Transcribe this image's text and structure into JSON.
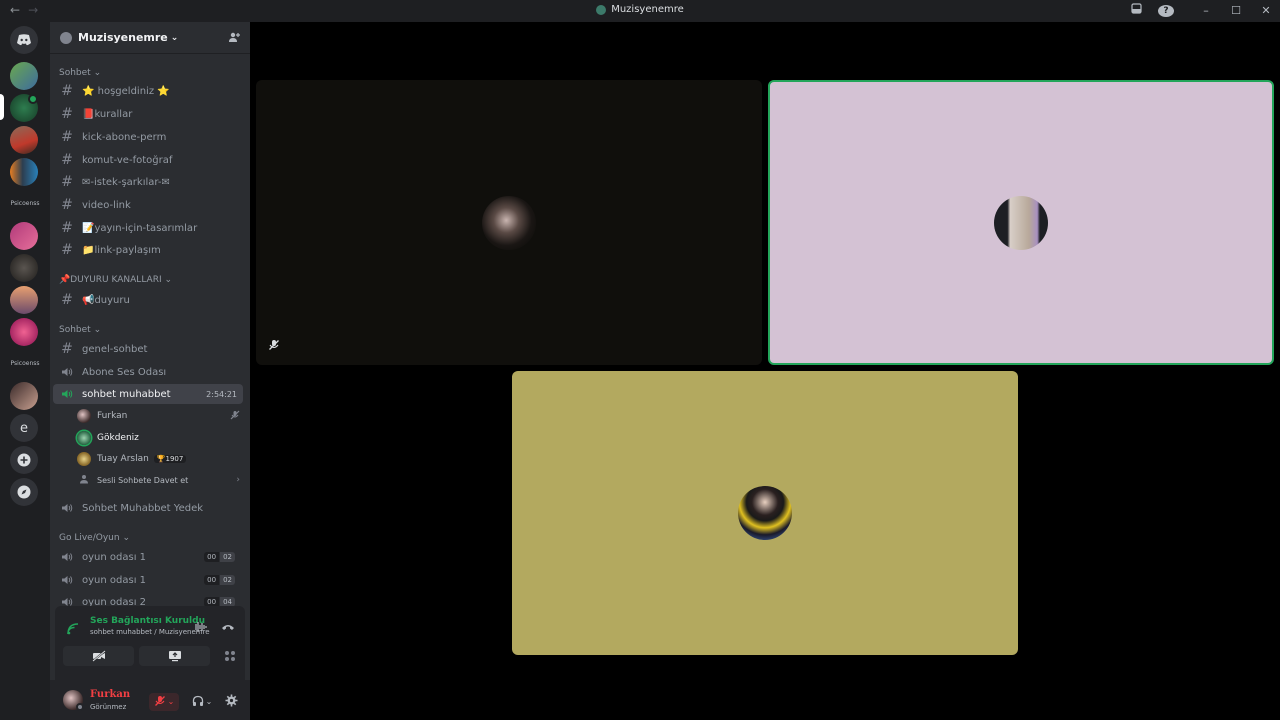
{
  "window": {
    "title": "Muzisyenemre"
  },
  "rail": {
    "folder_label_1": "Psicoenss",
    "folder_label_2": "Psicoenss",
    "letter_server": "e"
  },
  "guild": {
    "name": "Muzisyenemre"
  },
  "categories": {
    "c1": "Sohbet",
    "c2": "📌DUYURU KANALLARI",
    "c3": "Sohbet",
    "c4": "Go Live/Oyun"
  },
  "channels": {
    "hosgeldiniz": "⭐ hoşgeldiniz ⭐",
    "kurallar": "📕kurallar",
    "kick": "kick-abone-perm",
    "komut": "komut-ve-fotoğraf",
    "istek": "✉-istek-şarkılar-✉",
    "video": "video-link",
    "yayin": "📝yayın-için-tasarımlar",
    "link": "📁link-paylaşım",
    "duyuru": "📢duyuru",
    "genel": "genel-sohbet",
    "abone": "Abone Ses Odası",
    "sohbet": "sohbet muhabbet",
    "sohbet_timer": "2:54:21",
    "yedek": "Sohbet Muhabbet Yedek",
    "oyun1": "oyun odası 1",
    "oyun1_a": "00",
    "oyun1_b": "02",
    "oyun2": "oyun odası 1",
    "oyun2_a": "00",
    "oyun2_b": "02",
    "oyun3": "oyun odası 2",
    "oyun3_a": "00",
    "oyun3_b": "04"
  },
  "voice_users": {
    "u1": "Furkan",
    "u2": "Gökdeniz",
    "u3": "Tuay Arslan",
    "u3_tag": "🏆1907",
    "invite": "Sesli Sohbete Davet et"
  },
  "voice_panel": {
    "status": "Ses Bağlantısı Kuruldu",
    "sub": "sohbet muhabbet / Muzisyenemre"
  },
  "user_panel": {
    "name": "Furkan",
    "status": "Görünmez"
  },
  "colors": {
    "connected": "#23a55a",
    "muted": "#f23f43",
    "tile1": "#100f0c",
    "tile2": "#d4c2d4",
    "tile3": "#b3a95f",
    "speaking_border": "#23a55a"
  }
}
